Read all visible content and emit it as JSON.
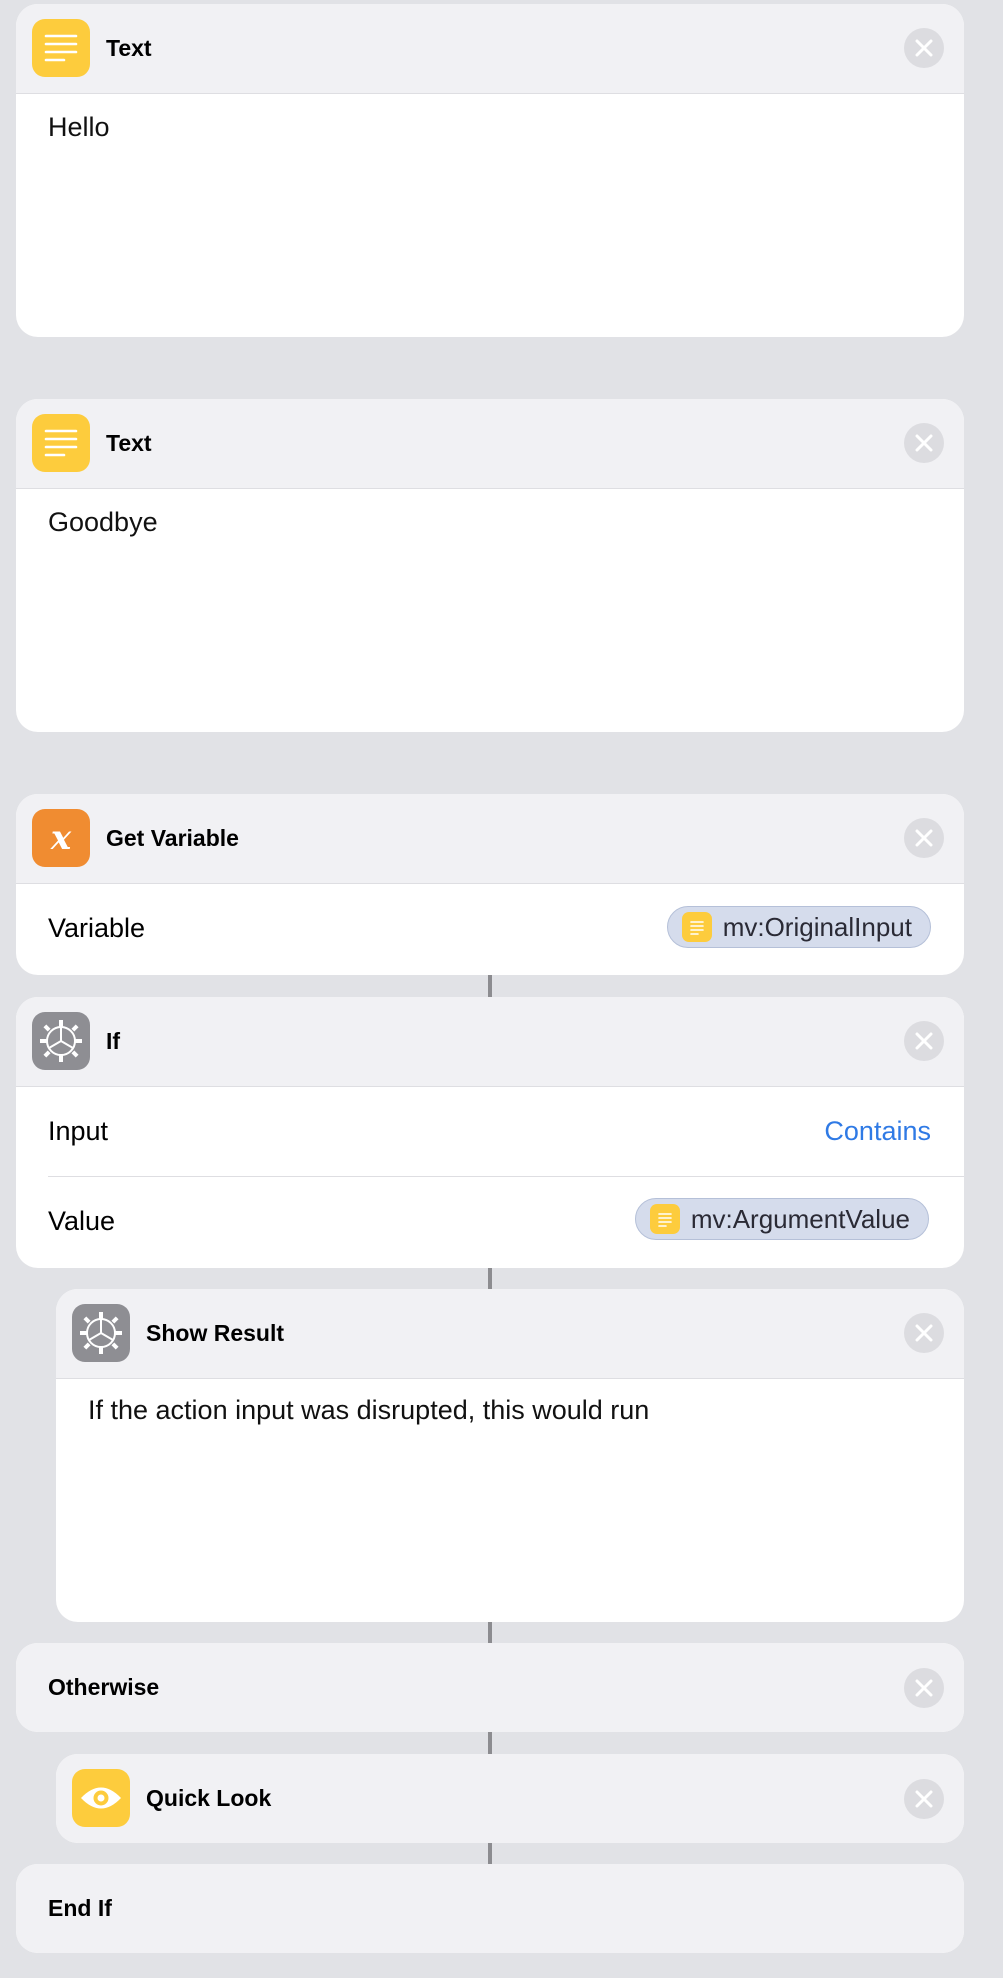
{
  "actions": {
    "text1": {
      "title": "Text",
      "content": "Hello"
    },
    "text2": {
      "title": "Text",
      "content": "Goodbye"
    },
    "get_variable": {
      "title": "Get Variable",
      "field_label": "Variable",
      "variable": "mv:OriginalInput"
    },
    "if": {
      "title": "If",
      "input_label": "Input",
      "condition": "Contains",
      "value_label": "Value",
      "value": "mv:ArgumentValue"
    },
    "show_result": {
      "title": "Show Result",
      "content": "If the action input was disrupted, this would run"
    },
    "otherwise": {
      "title": "Otherwise"
    },
    "quick_look": {
      "title": "Quick Look"
    },
    "end_if": {
      "title": "End If"
    }
  },
  "icons": {
    "text": "text-lines-icon",
    "variable": "variable-x-icon",
    "scripting": "gear-icon",
    "quick_look": "eye-icon",
    "close": "close-icon"
  },
  "colors": {
    "background": "#e1e2e6",
    "card": "#ffffff",
    "header": "#f1f1f4",
    "text_icon": "#fdcc3d",
    "variable_icon": "#f08c31",
    "scripting_icon": "#8e8e93",
    "link": "#2f7ae5",
    "pill": "#d5dcec"
  }
}
